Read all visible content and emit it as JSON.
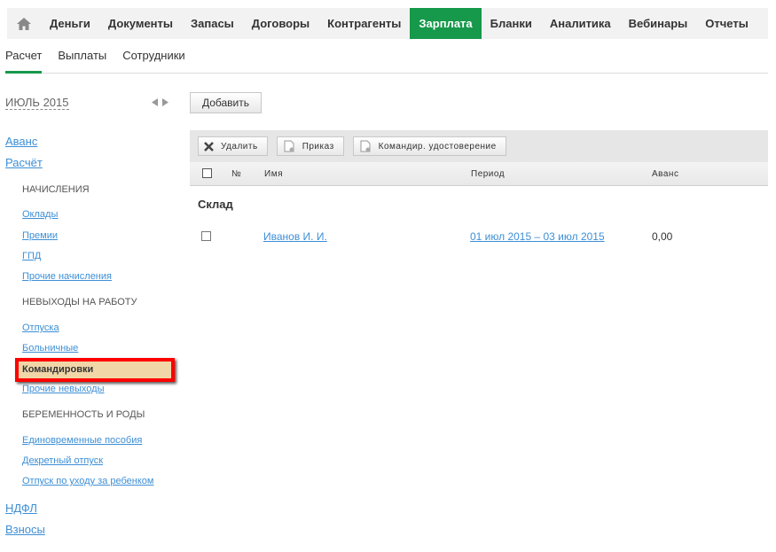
{
  "nav": {
    "items": [
      "Деньги",
      "Документы",
      "Запасы",
      "Договоры",
      "Контрагенты",
      "Зарплата",
      "Бланки",
      "Аналитика",
      "Вебинары",
      "Отчеты"
    ],
    "active": "Зарплата"
  },
  "subtabs": [
    "Расчет",
    "Выплаты",
    "Сотрудники"
  ],
  "month": "ИЮЛЬ 2015",
  "sidebar": {
    "avans": "Аванс",
    "raschet": "Расчёт",
    "nachisleniya": "НАЧИСЛЕНИЯ",
    "oklady": "Оклады",
    "premii": "Премии",
    "gpd": "ГПД",
    "prochie_nach": "Прочие начисления",
    "nevyhody": "НЕВЫХОДЫ НА РАБОТУ",
    "otpuska": "Отпуска",
    "bolnichnye": "Больничные",
    "komandirovki": "Командировки",
    "prochie_nev": "Прочие невыходы",
    "beremennost": "БЕРЕМЕННОСТЬ И РОДЫ",
    "edinovr": "Единовременные пособия",
    "dekret": "Декретный отпуск",
    "otpusk_uhod": "Отпуск по уходу за ребенком",
    "ndfl": "НДФЛ",
    "vznosy": "Взносы"
  },
  "add_label": "Добавить",
  "toolbar": {
    "delete": "Удалить",
    "prikaz": "Приказ",
    "udost": "Командир. удостоверение"
  },
  "table": {
    "headers": {
      "num": "№",
      "name": "Имя",
      "period": "Период",
      "avans": "Аванс"
    },
    "group": "Склад",
    "rows": [
      {
        "name": "Иванов И. И.",
        "period": "01 июл 2015 – 03 июл 2015",
        "avans": "0,00"
      }
    ]
  },
  "colors": {
    "accent": "#16994a",
    "link": "#3d8fd6",
    "highlight": "#f1d6a8"
  }
}
